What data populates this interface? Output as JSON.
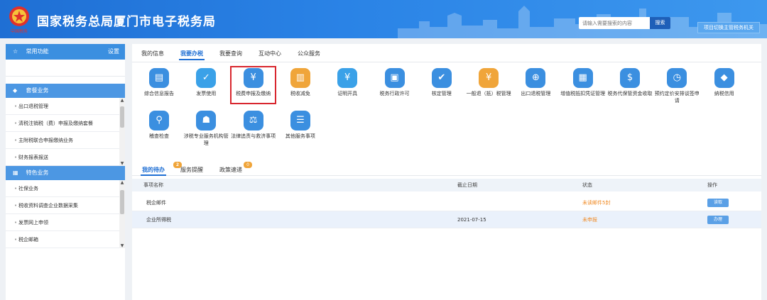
{
  "header": {
    "site_title": "国家税务总局厦门市电子税务局",
    "search_placeholder": "请输入需要搜索的内容",
    "search_label": "搜索",
    "switch_label": "项目切换主管税务机关",
    "emblem_caption": "中国税务"
  },
  "sidebar": {
    "common_title": "常用功能",
    "common_settings": "设置",
    "section1_title": "套餐业务",
    "section1_items": [
      "出口退税管理",
      "清税注销税（费）申报及缴纳套餐",
      "主附税联合申报缴纳业务",
      "财务报表报送"
    ],
    "section2_title": "特色业务",
    "section2_items": [
      "社保业务",
      "税收资料调查企业数据采集",
      "发票网上申领",
      "税企邮箱"
    ]
  },
  "main": {
    "tabs": [
      "我的信息",
      "我要办税",
      "我要查询",
      "互动中心",
      "公众服务"
    ],
    "active_tab": "我要办税",
    "functions_row1": [
      {
        "label": "综合信息报告",
        "icon": "report-icon",
        "color": "#3b8fe0"
      },
      {
        "label": "发票使用",
        "icon": "invoice-icon",
        "color": "#3aa1e8"
      },
      {
        "label": "税费申报及缴纳",
        "icon": "declaration-icon",
        "color": "#3b8fe0"
      },
      {
        "label": "税收减免",
        "icon": "tax-relief-icon",
        "color": "#f0a53a"
      },
      {
        "label": "证明开具",
        "icon": "certificate-icon",
        "color": "#3aa1e8"
      },
      {
        "label": "税务行政许可",
        "icon": "license-icon",
        "color": "#3b8fe0"
      },
      {
        "label": "核定管理",
        "icon": "verification-icon",
        "color": "#3b8fe0"
      },
      {
        "label": "一般退（抵）税管理",
        "icon": "refund-icon",
        "color": "#f0a53a"
      },
      {
        "label": "出口退税管理",
        "icon": "export-rebate-icon",
        "color": "#3b8fe0"
      },
      {
        "label": "增值税抵扣凭证管理",
        "icon": "vat-voucher-icon",
        "color": "#3b8fe0"
      },
      {
        "label": "税务代保管资金收取",
        "icon": "money-bag-icon",
        "color": "#3b8fe0"
      },
      {
        "label": "预约定价安排谈签申请",
        "icon": "appointment-icon",
        "color": "#3b8fe0"
      },
      {
        "label": "纳税信用",
        "icon": "credit-icon",
        "color": "#3b8fe0"
      }
    ],
    "functions_row2": [
      {
        "label": "稽查检查",
        "icon": "inspection-icon",
        "color": "#3b8fe0"
      },
      {
        "label": "涉税专业服务机构管理",
        "icon": "agency-icon",
        "color": "#3b8fe0"
      },
      {
        "label": "法律追责与救济事项",
        "icon": "gavel-icon",
        "color": "#3b8fe0"
      },
      {
        "label": "其他服务事项",
        "icon": "other-services-icon",
        "color": "#3b8fe0"
      }
    ],
    "highlighted_function": "税费申报及缴纳"
  },
  "todo": {
    "tabs": [
      {
        "label": "我的待办",
        "badge": "2"
      },
      {
        "label": "服务提醒",
        "badge": ""
      },
      {
        "label": "政策速递",
        "badge": "0"
      }
    ],
    "columns": [
      "事项名称",
      "截止日期",
      "状态",
      "操作"
    ],
    "rows": [
      {
        "name": "税企邮件",
        "deadline": "",
        "status": "未读邮件5封",
        "action": "读取"
      },
      {
        "name": "企业所得税",
        "deadline": "2021-07-15",
        "status": "未申报",
        "action": "办理"
      }
    ]
  }
}
